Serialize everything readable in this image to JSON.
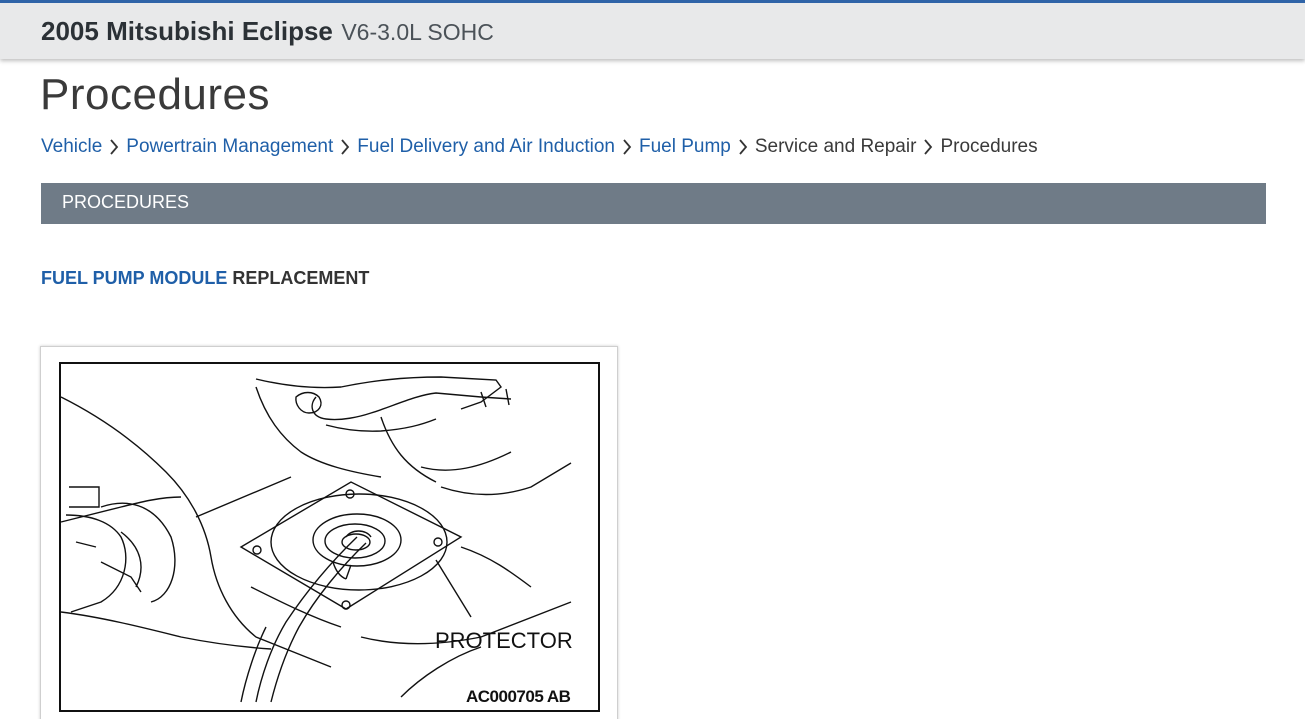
{
  "header": {
    "vehicle_name": "2005 Mitsubishi Eclipse",
    "vehicle_engine": "V6-3.0L SOHC",
    "accent_color": "#2f64a8"
  },
  "page": {
    "title": "Procedures"
  },
  "breadcrumb": {
    "items": [
      {
        "label": "Vehicle",
        "link": true
      },
      {
        "label": "Powertrain Management",
        "link": true
      },
      {
        "label": "Fuel Delivery and Air Induction",
        "link": true
      },
      {
        "label": "Fuel Pump",
        "link": true
      },
      {
        "label": "Service and Repair",
        "link": false
      },
      {
        "label": "Procedures",
        "link": false
      }
    ],
    "separator_icon": "chevron-right-icon"
  },
  "section": {
    "title": "PROCEDURES",
    "bar_color": "#6f7b87"
  },
  "content": {
    "heading_link": "FUEL PUMP MODULE",
    "heading_rest": "REPLACEMENT",
    "link_color": "#1f5fa8"
  },
  "figure": {
    "label": "PROTECTOR",
    "code": "AC000705 AB"
  }
}
